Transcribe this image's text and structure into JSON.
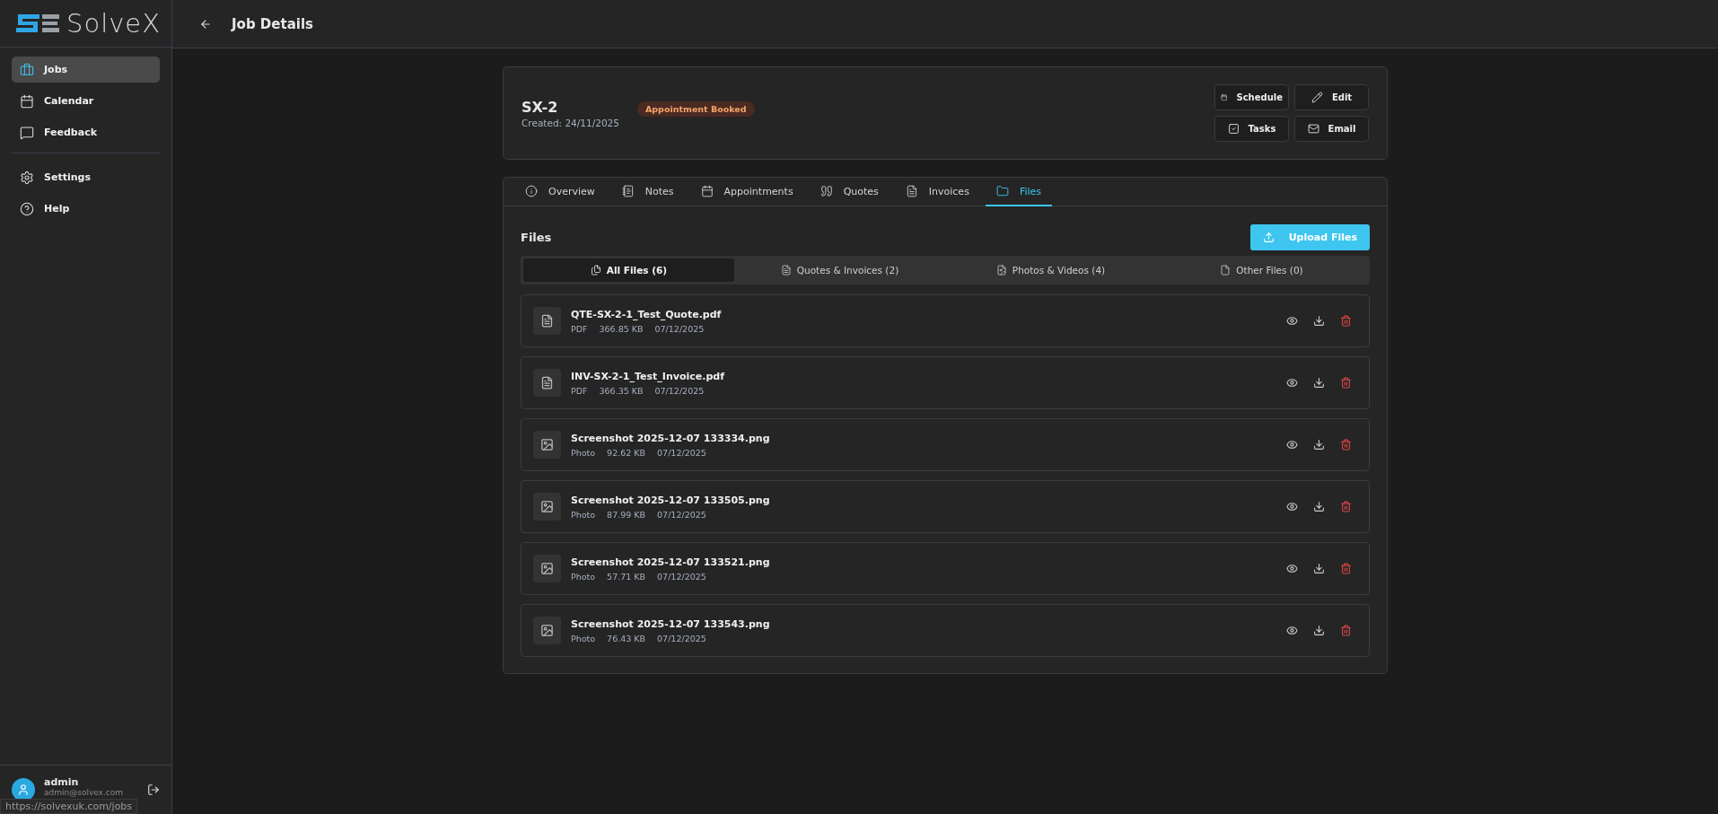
{
  "logo": {
    "text": "SolveX"
  },
  "sidebar": {
    "items": [
      {
        "label": "Jobs",
        "selected": true
      },
      {
        "label": "Calendar",
        "selected": false
      },
      {
        "label": "Feedback",
        "selected": false
      },
      {
        "label": "Settings",
        "selected": false
      },
      {
        "label": "Help",
        "selected": false
      }
    ],
    "user": {
      "name": "admin",
      "email": "admin@solvex.com"
    }
  },
  "header": {
    "title": "Job Details"
  },
  "job": {
    "id": "SX-2",
    "created": "Created: 24/11/2025",
    "status": "Appointment Booked",
    "actions": [
      "Schedule",
      "Edit",
      "Tasks",
      "Email"
    ]
  },
  "tabs": [
    {
      "label": "Overview",
      "selected": false
    },
    {
      "label": "Notes",
      "selected": false
    },
    {
      "label": "Appointments",
      "selected": false
    },
    {
      "label": "Quotes",
      "selected": false
    },
    {
      "label": "Invoices",
      "selected": false
    },
    {
      "label": "Files",
      "selected": true
    }
  ],
  "files_panel": {
    "title": "Files",
    "upload_button": "Upload Files",
    "filters": [
      {
        "label": "All Files (6)",
        "selected": true
      },
      {
        "label": "Quotes & Invoices (2)",
        "selected": false
      },
      {
        "label": "Photos & Videos (4)",
        "selected": false
      },
      {
        "label": "Other Files (0)",
        "selected": false
      }
    ],
    "files": [
      {
        "name": "QTE-SX-2-1_Test_Quote.pdf",
        "kind": "document",
        "type": "PDF",
        "size": "366.85 KB",
        "date": "07/12/2025"
      },
      {
        "name": "INV-SX-2-1_Test_Invoice.pdf",
        "kind": "document",
        "type": "PDF",
        "size": "366.35 KB",
        "date": "07/12/2025"
      },
      {
        "name": "Screenshot 2025-12-07 133334.png",
        "kind": "photo",
        "type": "Photo",
        "size": "92.62 KB",
        "date": "07/12/2025"
      },
      {
        "name": "Screenshot 2025-12-07 133505.png",
        "kind": "photo",
        "type": "Photo",
        "size": "87.99 KB",
        "date": "07/12/2025"
      },
      {
        "name": "Screenshot 2025-12-07 133521.png",
        "kind": "photo",
        "type": "Photo",
        "size": "57.71 KB",
        "date": "07/12/2025"
      },
      {
        "name": "Screenshot 2025-12-07 133543.png",
        "kind": "photo",
        "type": "Photo",
        "size": "76.43 KB",
        "date": "07/12/2025"
      }
    ]
  },
  "status_bar": {
    "url": "https://solvexuk.com/jobs"
  }
}
